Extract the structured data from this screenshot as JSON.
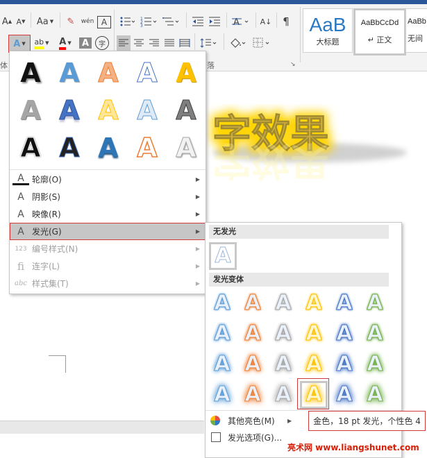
{
  "ribbon": {
    "font_group_label": "体",
    "para_group_label": "落",
    "buttons": {
      "grow_font": "A",
      "shrink_font": "A",
      "change_case": "Aa",
      "clear_format": "✎",
      "phonetic": "wén",
      "char_border": "A",
      "text_effects": "A",
      "highlight": "ab",
      "font_color": "A",
      "char_shading": "A",
      "enclose_char": "字",
      "sort": "A↓",
      "show_marks": "¶"
    },
    "styles": [
      {
        "preview": "AaB",
        "name": "大标题"
      },
      {
        "preview": "AaBbCcDd",
        "name": "↵ 正文"
      },
      {
        "preview": "AaBb",
        "name": "无间"
      }
    ]
  },
  "document": {
    "glow_text": "字效果"
  },
  "effects_menu": {
    "gallery": [
      "A",
      "A",
      "A",
      "A",
      "A",
      "A",
      "A",
      "A",
      "A",
      "A",
      "A",
      "A",
      "A",
      "A",
      "A"
    ],
    "items": [
      {
        "label": "轮廓(O)",
        "icon": "A",
        "disabled": false
      },
      {
        "label": "阴影(S)",
        "icon": "A",
        "disabled": false
      },
      {
        "label": "映像(R)",
        "icon": "A",
        "disabled": false
      },
      {
        "label": "发光(G)",
        "icon": "A",
        "disabled": false
      },
      {
        "label": "编号样式(N)",
        "icon": "123",
        "disabled": true
      },
      {
        "label": "连字(L)",
        "icon": "fi",
        "disabled": true
      },
      {
        "label": "样式集(T)",
        "icon": "abc",
        "disabled": true
      }
    ]
  },
  "glow_menu": {
    "no_glow_header": "无发光",
    "variants_header": "发光变体",
    "glyph": "A",
    "more_colors": "其他亮色(M)",
    "glow_options": "发光选项(G)..."
  },
  "tooltip": "金色，18 pt 发光，个性色 4",
  "watermark": "亮术网 www.liangshunet.com",
  "colors": {
    "glow_palette": [
      "#5b9bd5",
      "#ed7d31",
      "#a5a5a5",
      "#ffc000",
      "#4472c4",
      "#70ad47"
    ],
    "highlight": "#d23b3b"
  }
}
